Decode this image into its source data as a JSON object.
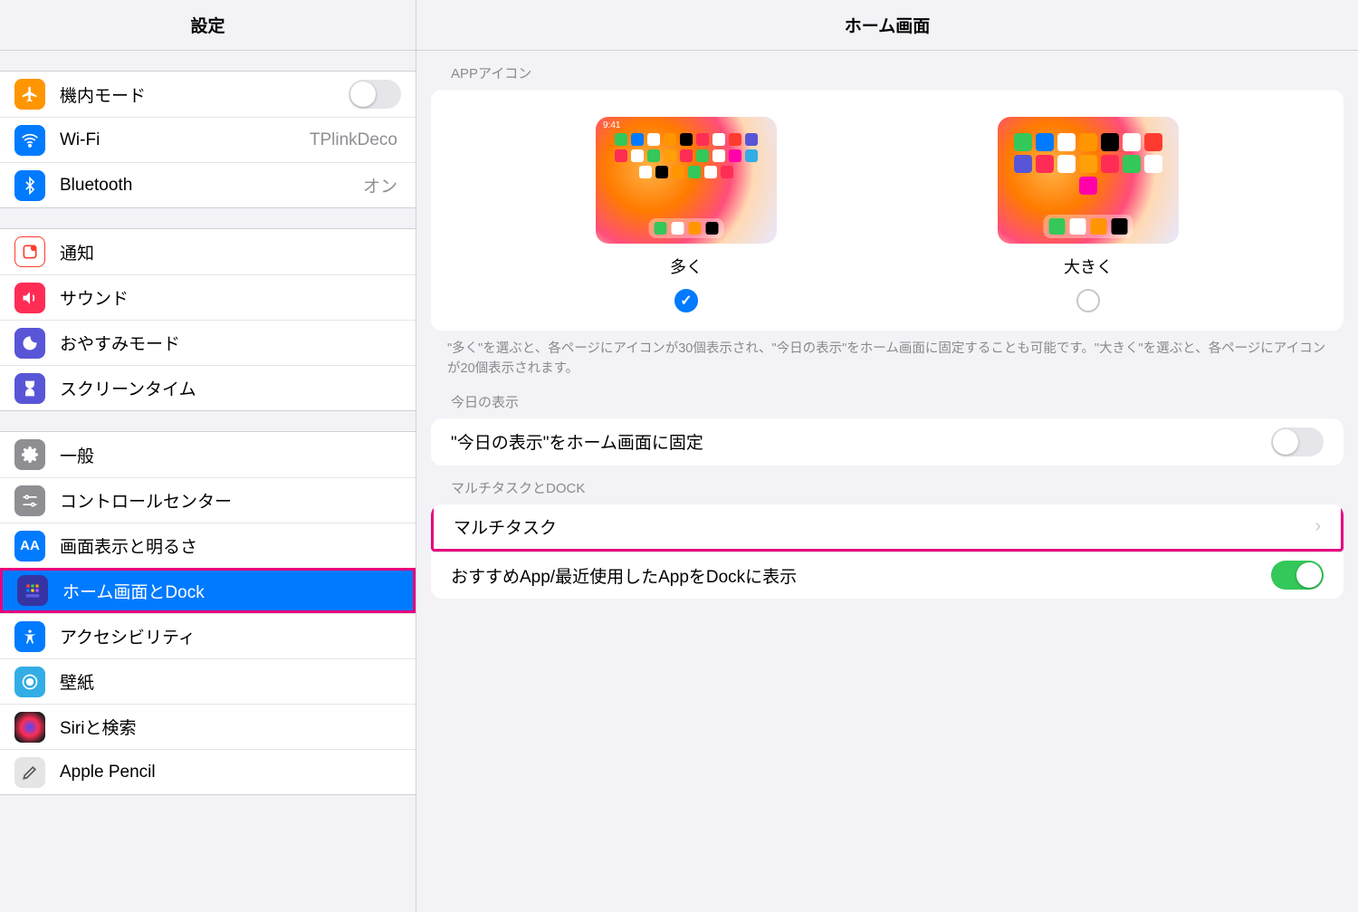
{
  "sidebar": {
    "title": "設定",
    "group1": [
      {
        "key": "airplane",
        "label": "機内モード",
        "switch_off": true
      },
      {
        "key": "wifi",
        "label": "Wi-Fi",
        "value": "TPlinkDeco"
      },
      {
        "key": "bt",
        "label": "Bluetooth",
        "value": "オン"
      }
    ],
    "group2": [
      {
        "key": "notif",
        "label": "通知"
      },
      {
        "key": "sound",
        "label": "サウンド"
      },
      {
        "key": "dnd",
        "label": "おやすみモード"
      },
      {
        "key": "st",
        "label": "スクリーンタイム"
      }
    ],
    "group3": [
      {
        "key": "gen",
        "label": "一般"
      },
      {
        "key": "cc",
        "label": "コントロールセンター"
      },
      {
        "key": "disp",
        "label": "画面表示と明るさ"
      },
      {
        "key": "home",
        "label": "ホーム画面とDock"
      },
      {
        "key": "acc",
        "label": "アクセシビリティ"
      },
      {
        "key": "wall",
        "label": "壁紙"
      },
      {
        "key": "siri",
        "label": "Siriと検索"
      },
      {
        "key": "pen",
        "label": "Apple Pencil"
      }
    ]
  },
  "content": {
    "title": "ホーム画面",
    "section_appicon_header": "APPアイコン",
    "appicon_option_more": "多く",
    "appicon_option_bigger": "大きく",
    "appicon_preview_time": "9:41",
    "appicon_selected": "more",
    "appicon_footer": "\"多く\"を選ぶと、各ページにアイコンが30個表示され、\"今日の表示\"をホーム画面に固定することも可能です。\"大きく\"を選ぶと、各ページにアイコンが20個表示されます。",
    "section_today_header": "今日の表示",
    "today_pin_label": "\"今日の表示\"をホーム画面に固定",
    "section_multi_header": "マルチタスクとDOCK",
    "multitask_label": "マルチタスク",
    "dock_suggest_label": "おすすめApp/最近使用したAppをDockに表示"
  }
}
